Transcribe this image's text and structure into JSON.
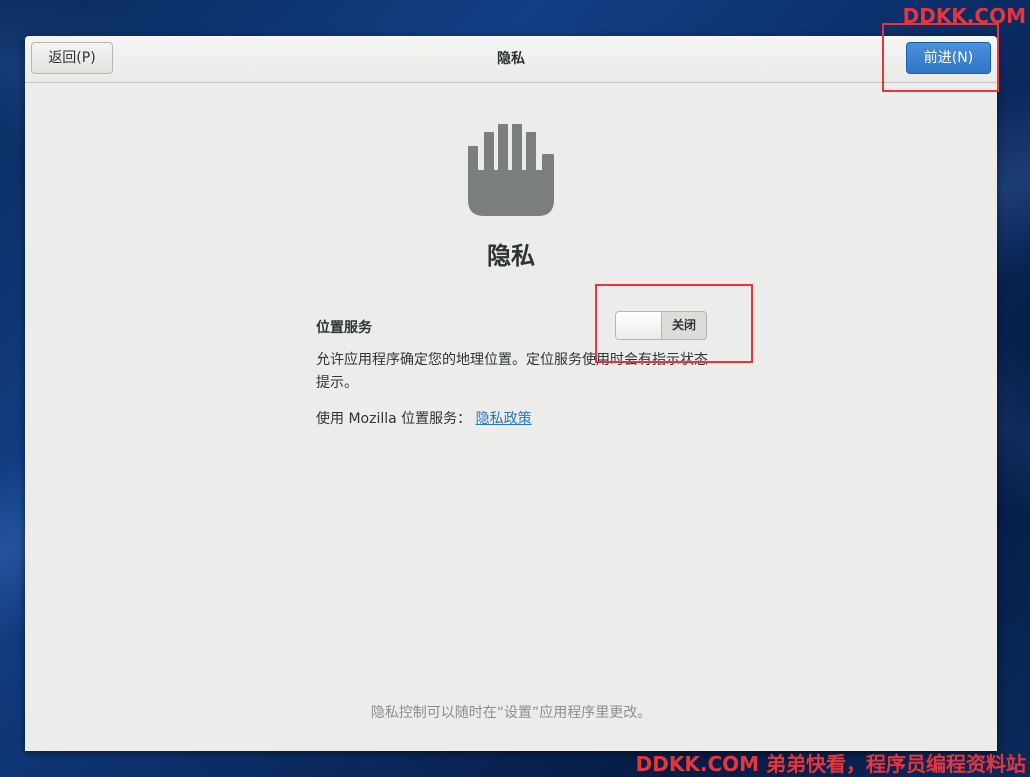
{
  "header": {
    "back_label": "返回(P)",
    "title": "隐私",
    "next_label": "前进(N)"
  },
  "page": {
    "title": "隐私",
    "icon": "hand-stop-icon",
    "location_service_label": "位置服务",
    "location_toggle_state": "关闭",
    "location_description": "允许应用程序确定您的地理位置。定位服务使用时会有指示状态提示。",
    "mozilla_prefix": "使用 Mozilla 位置服务：",
    "privacy_policy_link": "隐私政策",
    "footer_note": "隐私控制可以随时在“设置”应用程序里更改。"
  },
  "watermark": {
    "top": "DDKK.COM",
    "bottom": "DDKK.COM 弟弟快看，程序员编程资料站"
  },
  "colors": {
    "accent": "#2f78c8",
    "highlight": "#e8343a",
    "link": "#2a76c6"
  }
}
